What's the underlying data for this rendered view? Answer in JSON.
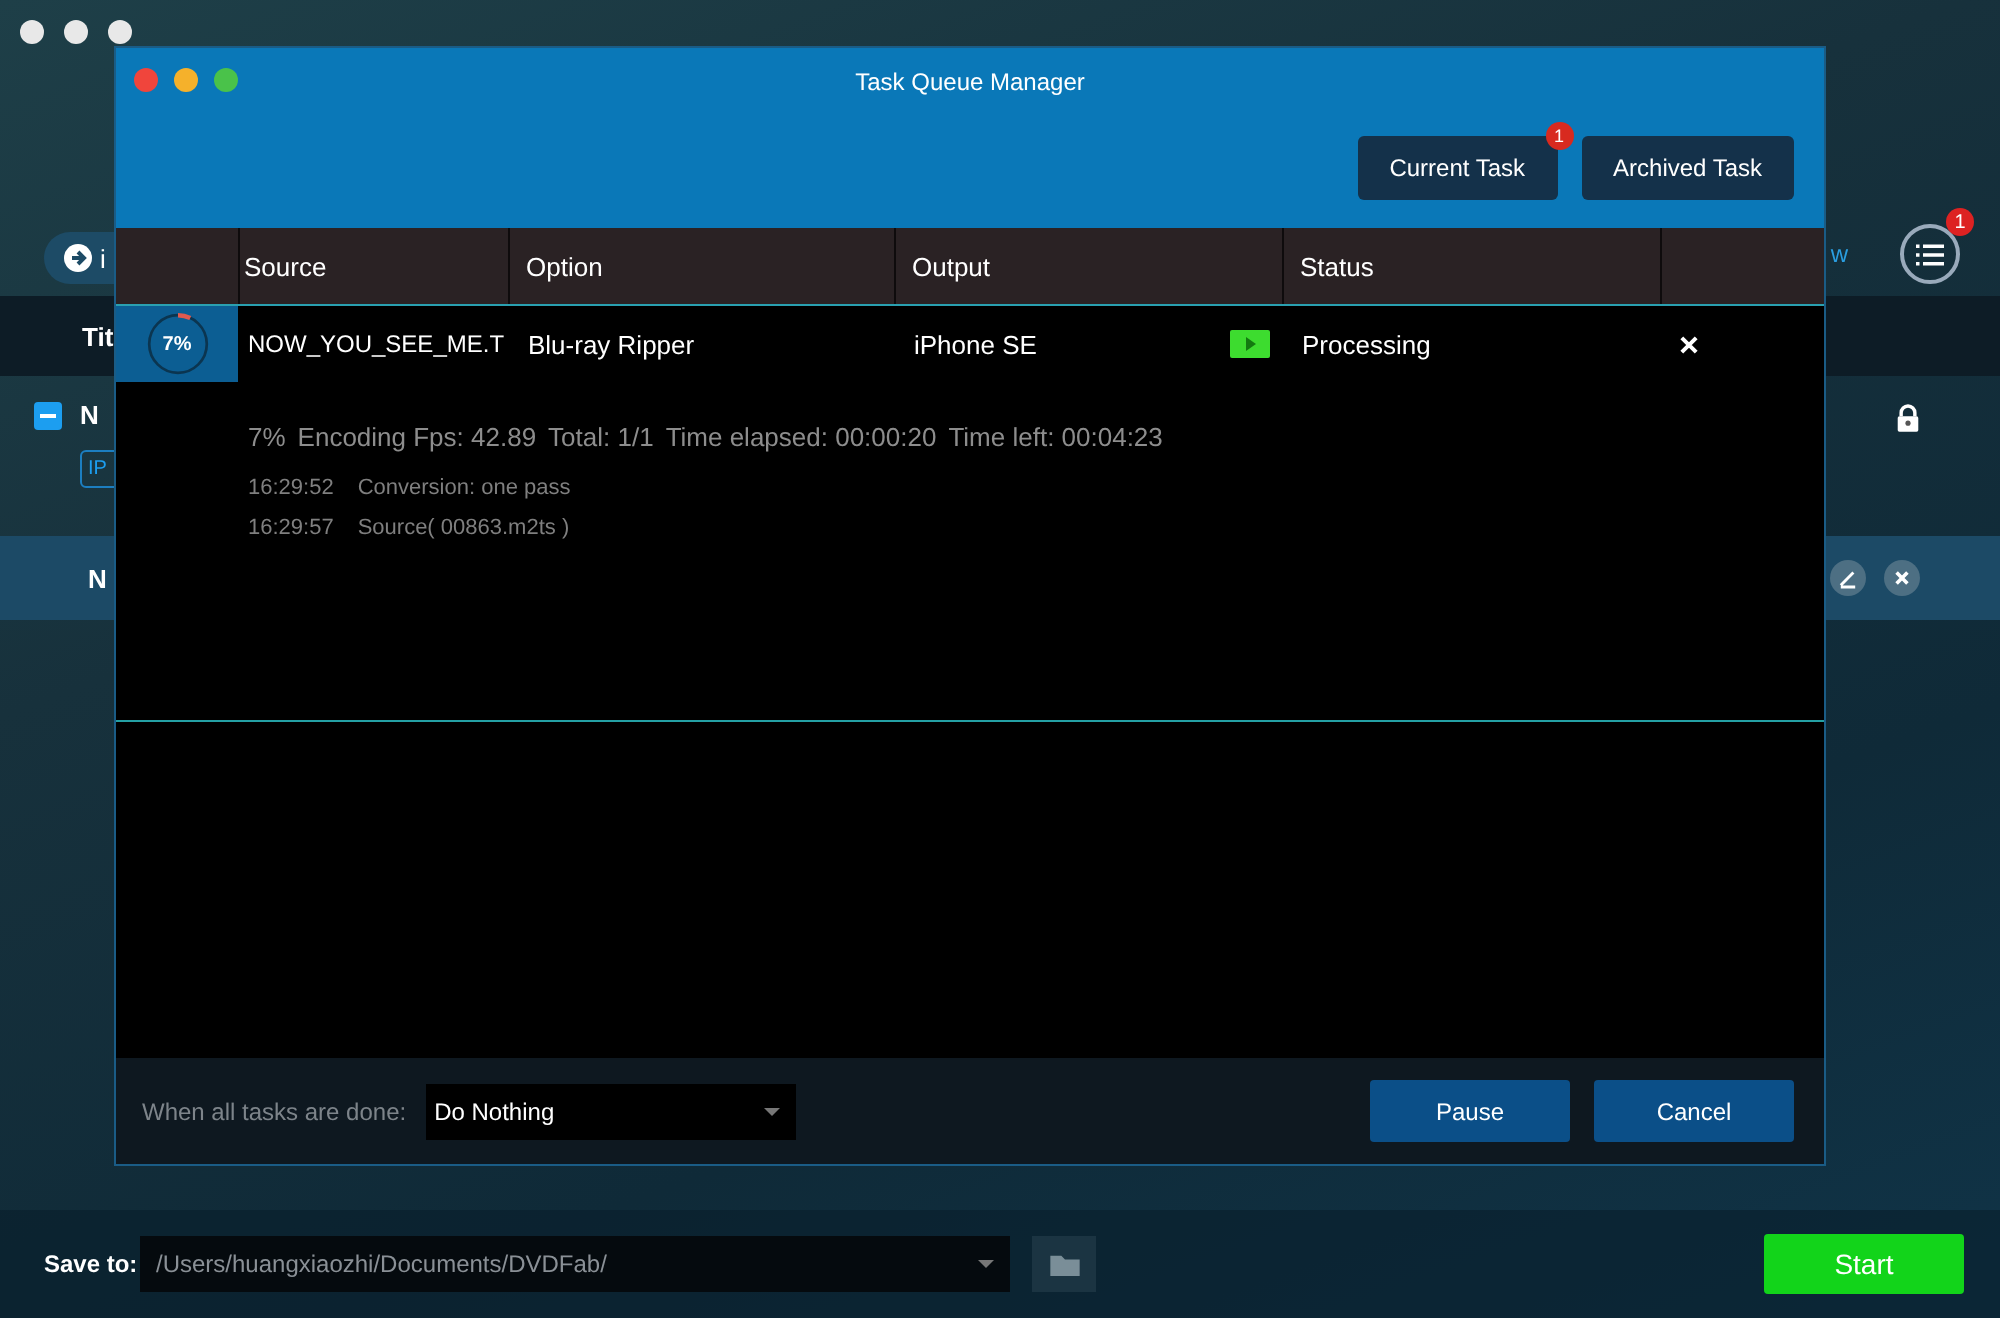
{
  "background": {
    "toolbar_button_text": "i",
    "column_header": "Tit",
    "title_row_text": "N",
    "tag": "IP",
    "selected_row_text": "N",
    "toolbar_link_text": "w",
    "queue_badge": "1"
  },
  "dialog": {
    "title": "Task Queue Manager",
    "tabs": [
      {
        "label": "Current Task",
        "badge": "1"
      },
      {
        "label": "Archived Task"
      }
    ],
    "columns": [
      "Source",
      "Option",
      "Output",
      "Status"
    ],
    "task": {
      "progress_label": "7%",
      "level": 0.07,
      "source": "NOW_YOU_SEE_ME.T",
      "option": "Blu-ray Ripper",
      "output": "iPhone SE",
      "status": "Processing",
      "summary": [
        "7%",
        "Encoding Fps: 42.89",
        "Total: 1/1",
        "Time elapsed: 00:00:20",
        "Time left: 00:04:23"
      ],
      "log": [
        {
          "time": "16:29:52",
          "message": "Conversion: one pass"
        },
        {
          "time": "16:29:57",
          "message": "Source( 00863.m2ts )"
        }
      ]
    },
    "footer": {
      "label": "When all tasks are done:",
      "value": "Do Nothing",
      "buttons": [
        "Pause",
        "Cancel"
      ]
    }
  },
  "bottom_bar": {
    "label": "Save to:",
    "path": "/Users/huangxiaozhi/Documents/DVDFab/",
    "start": "Start"
  }
}
